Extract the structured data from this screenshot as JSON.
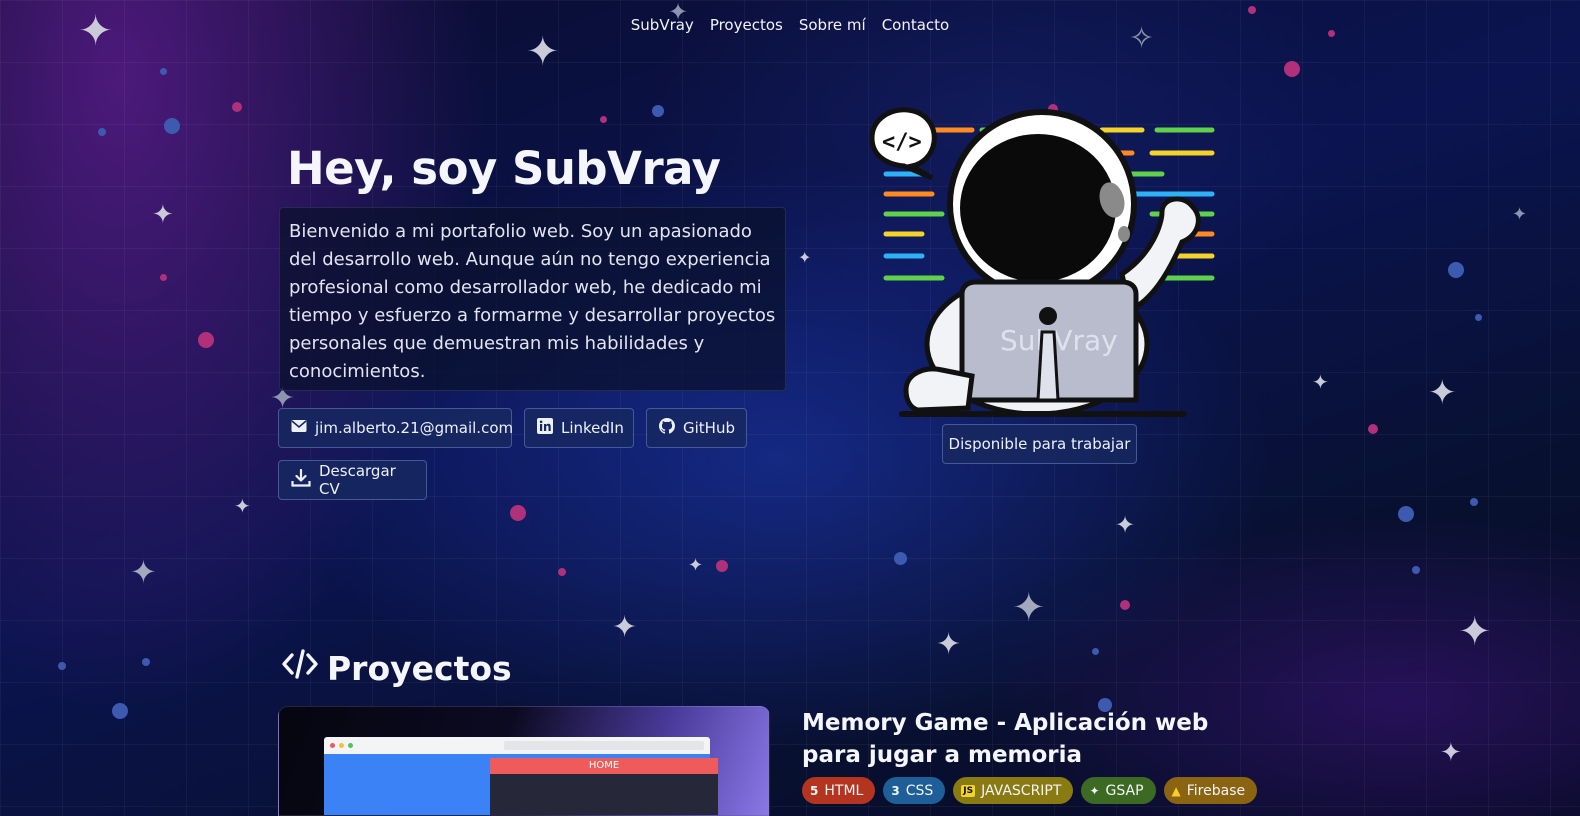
{
  "nav": {
    "items": [
      {
        "label": "SubVray"
      },
      {
        "label": "Proyectos"
      },
      {
        "label": "Sobre mí"
      },
      {
        "label": "Contacto"
      }
    ]
  },
  "hero": {
    "title": "Hey, soy SubVray",
    "intro": "Bienvenido a mi portafolio web. Soy un apasionado del desarrollo web. Aunque aún no tengo experiencia profesional como desarrollador web, he dedicado mi tiempo y esfuerzo a formarme y desarrollar proyectos personales que demuestran mis habilidades y conocimientos.",
    "buttons": {
      "email": "jim.alberto.21@gmail.com",
      "linkedin": "LinkedIn",
      "github": "GitHub",
      "cv": "Descargar CV"
    },
    "availability": "Disponible para trabajar",
    "illustration_text": "SubVray"
  },
  "projects": {
    "title": "Proyectos",
    "items": [
      {
        "title": "Memory Game - Aplicación web para jugar a memoria",
        "thumb_label": "HOME",
        "tags": [
          {
            "label": "HTML",
            "color": "#b5341f"
          },
          {
            "label": "CSS",
            "color": "#1e5f9a"
          },
          {
            "label": "JAVASCRIPT",
            "color": "#8a7a12"
          },
          {
            "label": "GSAP",
            "color": "#3d6a22"
          },
          {
            "label": "Firebase",
            "color": "#8a6410"
          }
        ]
      }
    ]
  },
  "colors": {
    "accent_button": "#162860",
    "background": "#0b1450"
  }
}
